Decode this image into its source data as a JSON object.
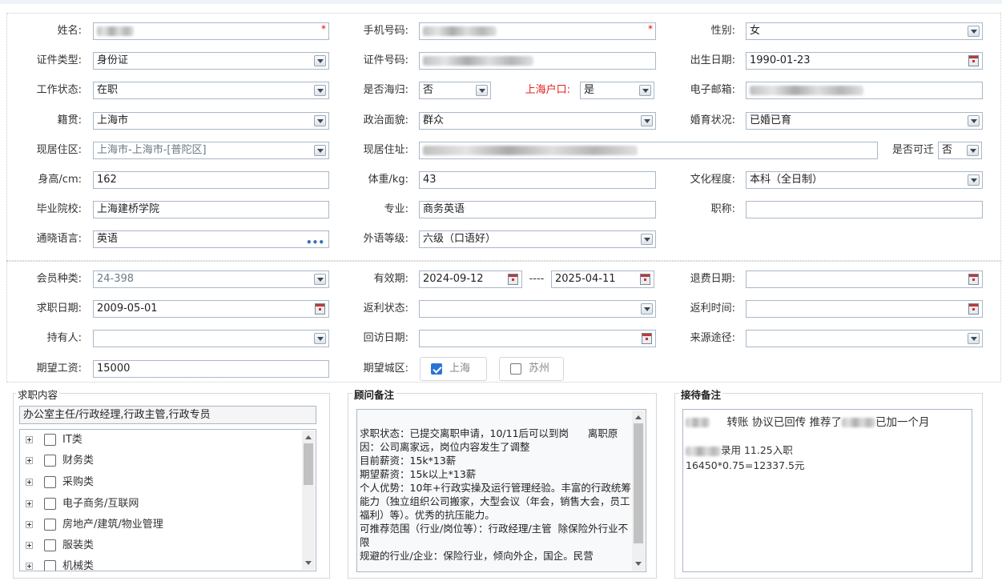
{
  "fields": {
    "name": {
      "label": "姓名:"
    },
    "phone": {
      "label": "手机号码:"
    },
    "gender": {
      "label": "性别:",
      "value": "女"
    },
    "id_type": {
      "label": "证件类型:",
      "value": "身份证"
    },
    "id_number": {
      "label": "证件号码:"
    },
    "birth_date": {
      "label": "出生日期:",
      "value": "1990-01-23"
    },
    "work_status": {
      "label": "工作状态:",
      "value": "在职"
    },
    "returnee": {
      "label": "是否海归:",
      "value": "否"
    },
    "shanghai_hukou": {
      "label": "上海户口:",
      "value": "是"
    },
    "email": {
      "label": "电子邮箱:"
    },
    "native_place": {
      "label": "籍贯:",
      "value": "上海市"
    },
    "political": {
      "label": "政治面貌:",
      "value": "群众"
    },
    "marital": {
      "label": "婚育状况:",
      "value": "已婚已育"
    },
    "residence_area": {
      "label": "现居住区:",
      "value": "上海市-上海市-[普陀区]"
    },
    "residence_address": {
      "label": "现居住址:"
    },
    "relocatable": {
      "label": "是否可迁",
      "value": "否"
    },
    "height": {
      "label": "身高/cm:",
      "value": "162"
    },
    "weight": {
      "label": "体重/kg:",
      "value": "43"
    },
    "education": {
      "label": "文化程度:",
      "value": "本科（全日制）"
    },
    "school": {
      "label": "毕业院校:",
      "value": "上海建桥学院"
    },
    "major": {
      "label": "专业:",
      "value": "商务英语"
    },
    "title": {
      "label": "职称:",
      "value": ""
    },
    "languages": {
      "label": "通晓语言:",
      "value": "英语"
    },
    "language_level": {
      "label": "外语等级:",
      "value": "六级（口语好）"
    },
    "member_type": {
      "label": "会员种类:",
      "value": "24-398"
    },
    "validity": {
      "label": "有效期:",
      "start": "2024-09-12",
      "separator": "----",
      "end": "2025-04-11"
    },
    "refund_date": {
      "label": "退费日期:",
      "value": ""
    },
    "job_search_date": {
      "label": "求职日期:",
      "value": "2009-05-01"
    },
    "rebate_status": {
      "label": "返利状态:",
      "value": ""
    },
    "rebate_time": {
      "label": "返利时间:",
      "value": ""
    },
    "holder": {
      "label": "持有人:",
      "value": ""
    },
    "visit_date": {
      "label": "回访日期:",
      "value": ""
    },
    "source": {
      "label": "来源途径:",
      "value": ""
    },
    "expected_salary": {
      "label": "期望工资:",
      "value": "15000"
    },
    "expected_city": {
      "label": "期望城区:",
      "options": [
        {
          "label": "上海",
          "checked": true
        },
        {
          "label": "苏州",
          "checked": false
        }
      ]
    }
  },
  "job_content": {
    "title": "求职内容",
    "summary": "办公室主任/行政经理,行政主管,行政专员",
    "categories": [
      "IT类",
      "财务类",
      "采购类",
      "电子商务/互联网",
      "房地产/建筑/物业管理",
      "服装类",
      "机械类"
    ]
  },
  "consultant_note": {
    "title": "顾问备注",
    "text": "求职状态：已提交离职申请，10/11后可以到岗      离职原因：公司离家远，岗位内容发生了调整\n目前薪资：15k*13薪\n期望薪资：15k以上*13薪\n个人优势：10年+行政实操及运行管理经验。丰富的行政统筹能力（独立组织公司搬家，大型会议（年会，销售大会，员工福利）等）。优秀的抗压能力。\n可推荐范围（行业/岗位等）：行政经理/主管  除保险外行业不限\n规避的行业/企业：保险行业，倾向外企，国企。民营"
  },
  "reception_note": {
    "title": "接待备注",
    "line1_a": "转账   协议已回传   推荐了",
    "line1_b": "已加一个月",
    "line2": "录用 11.25入职",
    "line3": "16450*0.75=12337.5元"
  },
  "colors": {
    "required": "#e00000",
    "hukou_label": "#e02020",
    "checkbox_checked": "#2a74d4"
  }
}
